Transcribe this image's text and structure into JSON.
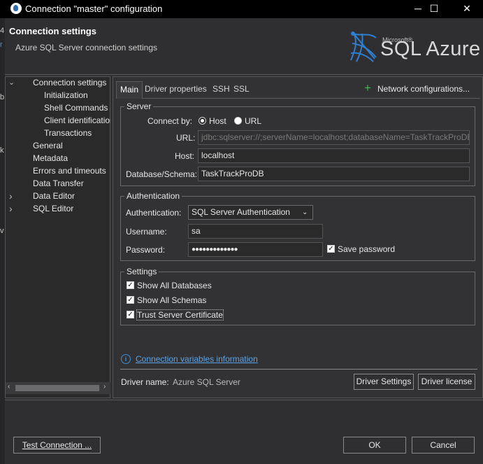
{
  "window": {
    "title": "Connection \"master\" configuration",
    "minimize": "─",
    "maximize": "☐",
    "close": "✕"
  },
  "edge_chars": [
    "4",
    "r",
    "b",
    "k",
    "v"
  ],
  "header": {
    "title": "Connection settings",
    "subtitle": "Azure SQL Server connection settings",
    "logo_small": "Microsoft®",
    "logo_text": "SQL Azure"
  },
  "tree": {
    "items": [
      {
        "label": "Connection settings",
        "level": 0,
        "chevron": "⌄"
      },
      {
        "label": "Initialization",
        "level": 1
      },
      {
        "label": "Shell Commands",
        "level": 1
      },
      {
        "label": "Client identification",
        "level": 1
      },
      {
        "label": "Transactions",
        "level": 1
      },
      {
        "label": "General",
        "level": 0
      },
      {
        "label": "Metadata",
        "level": 0
      },
      {
        "label": "Errors and timeouts",
        "level": 0
      },
      {
        "label": "Data Transfer",
        "level": 0
      },
      {
        "label": "Data Editor",
        "level": 0,
        "chevron": "›"
      },
      {
        "label": "SQL Editor",
        "level": 0,
        "chevron": "›"
      }
    ],
    "scroll_left": "‹",
    "scroll_right": "›"
  },
  "tabs": {
    "main": "Main",
    "driver_properties": "Driver properties",
    "ssh": "SSH",
    "ssl": "SSL",
    "network_icon": "+",
    "network_config": "Network configurations..."
  },
  "server": {
    "legend": "Server",
    "connect_by_label": "Connect by:",
    "host_option": "Host",
    "url_option": "URL",
    "url_label": "URL:",
    "url_value": "jdbc:sqlserver://;serverName=localhost;databaseName=TaskTrackProDB;",
    "host_label": "Host:",
    "host_value": "localhost",
    "db_label": "Database/Schema:",
    "db_value": "TaskTrackProDB"
  },
  "auth": {
    "legend": "Authentication",
    "auth_label": "Authentication:",
    "auth_value": "SQL Server Authentication",
    "dropdown_arrow": "⌄",
    "username_label": "Username:",
    "username_value": "sa",
    "password_label": "Password:",
    "password_value": "●●●●●●●●●●●●●",
    "save_password_label": "Save password",
    "check_mark": "✓"
  },
  "settings": {
    "legend": "Settings",
    "show_all_databases": "Show All Databases",
    "show_all_schemas": "Show All Schemas",
    "trust_cert": "Trust Server Certificate"
  },
  "info": {
    "icon": "i",
    "link": "Connection variables information"
  },
  "driver": {
    "label": "Driver name:",
    "value": "Azure SQL Server",
    "settings_button": "Driver Settings",
    "license_button": "Driver license"
  },
  "footer": {
    "test_button": "Test Connection ...",
    "ok_button": "OK",
    "cancel_button": "Cancel"
  },
  "colors": {
    "background": "#2f2f31",
    "titlebar": "#000000",
    "link": "#5aa3e8",
    "add_icon": "#3fb950"
  }
}
